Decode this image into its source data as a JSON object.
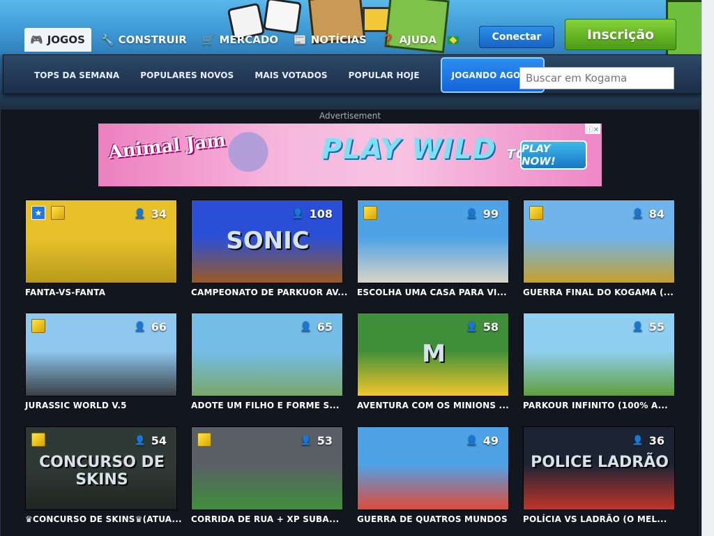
{
  "header": {
    "nav": [
      {
        "label": "JOGOS",
        "icon": "gamepad-icon"
      },
      {
        "label": "CONSTRUIR",
        "icon": "wrench-icon"
      },
      {
        "label": "MERCADO",
        "icon": "cart-icon"
      },
      {
        "label": "NOTÍCIAS",
        "icon": "newspaper-icon"
      },
      {
        "label": "AJUDA",
        "icon": "help-icon"
      }
    ],
    "flag_icon": "brazil-flag-icon",
    "connect_label": "Conectar",
    "signup_label": "Inscrição"
  },
  "subnav": {
    "tabs": [
      {
        "label": "TOPS DA SEMANA"
      },
      {
        "label": "POPULARES NOVOS"
      },
      {
        "label": "MAIS VOTADOS"
      },
      {
        "label": "POPULAR HOJE"
      },
      {
        "label": "JOGANDO AGORA"
      }
    ],
    "search_placeholder": "Buscar em Kogama"
  },
  "ad": {
    "label": "Advertisement",
    "brand": "Animal Jam",
    "headline": "PLAY WILD",
    "headline_suffix": "TODAY!",
    "cta": "PLAY NOW!"
  },
  "games": [
    {
      "title": "FANTA-VS-FANTA",
      "players": "34",
      "star": true,
      "cube": true,
      "colors": [
        "#e8c12a",
        "#b99a1c"
      ]
    },
    {
      "title": "CAMPEONATO DE PARKUOR AV...",
      "players": "108",
      "star": false,
      "cube": false,
      "colors": [
        "#2a4fd6",
        "#9a5a22"
      ],
      "art": "SONIC"
    },
    {
      "title": "ESCOLHA UMA CASA PARA VI...",
      "players": "99",
      "star": false,
      "cube": true,
      "colors": [
        "#4da3e6",
        "#d8d4c6"
      ]
    },
    {
      "title": "GUERRA FINAL DO KOGAMA (...",
      "players": "84",
      "star": false,
      "cube": true,
      "colors": [
        "#6fb4ea",
        "#c8a02a"
      ]
    },
    {
      "title": "JURASSIC WORLD V.5",
      "players": "66",
      "star": false,
      "cube": true,
      "colors": [
        "#8fc8ef",
        "#3a3f45"
      ]
    },
    {
      "title": "ADOTE UM FILHO E FORME S...",
      "players": "65",
      "star": false,
      "cube": false,
      "colors": [
        "#74bde8",
        "#7aa86a"
      ]
    },
    {
      "title": "AVENTURA COM OS MINIONS ...",
      "players": "58",
      "star": false,
      "cube": false,
      "colors": [
        "#3f8f3a",
        "#f2c62a"
      ],
      "art": "M"
    },
    {
      "title": "PARKOUR INFINITO (100% A...",
      "players": "55",
      "star": false,
      "cube": false,
      "colors": [
        "#8fd0f2",
        "#5f9e3a"
      ]
    },
    {
      "title": "♛CONCURSO DE SKINS♛(ATUA...",
      "players": "54",
      "star": false,
      "cube": true,
      "colors": [
        "#2f3a36",
        "#1f2622"
      ],
      "art": "CONCURSO DE SKINS"
    },
    {
      "title": "CORRIDA DE RUA + XP SUBA...",
      "players": "53",
      "star": false,
      "cube": true,
      "colors": [
        "#5a5f66",
        "#3f8f3a"
      ]
    },
    {
      "title": "GUERRA DE QUATROS MUNDOS",
      "players": "49",
      "star": false,
      "cube": false,
      "colors": [
        "#4da3e6",
        "#e24a3a"
      ]
    },
    {
      "title": "POLÍCIA VS LADRÃO (O MEL...",
      "players": "36",
      "star": false,
      "cube": false,
      "colors": [
        "#1c2433",
        "#c2342a"
      ],
      "art": "POLICE LADRÃO"
    }
  ]
}
